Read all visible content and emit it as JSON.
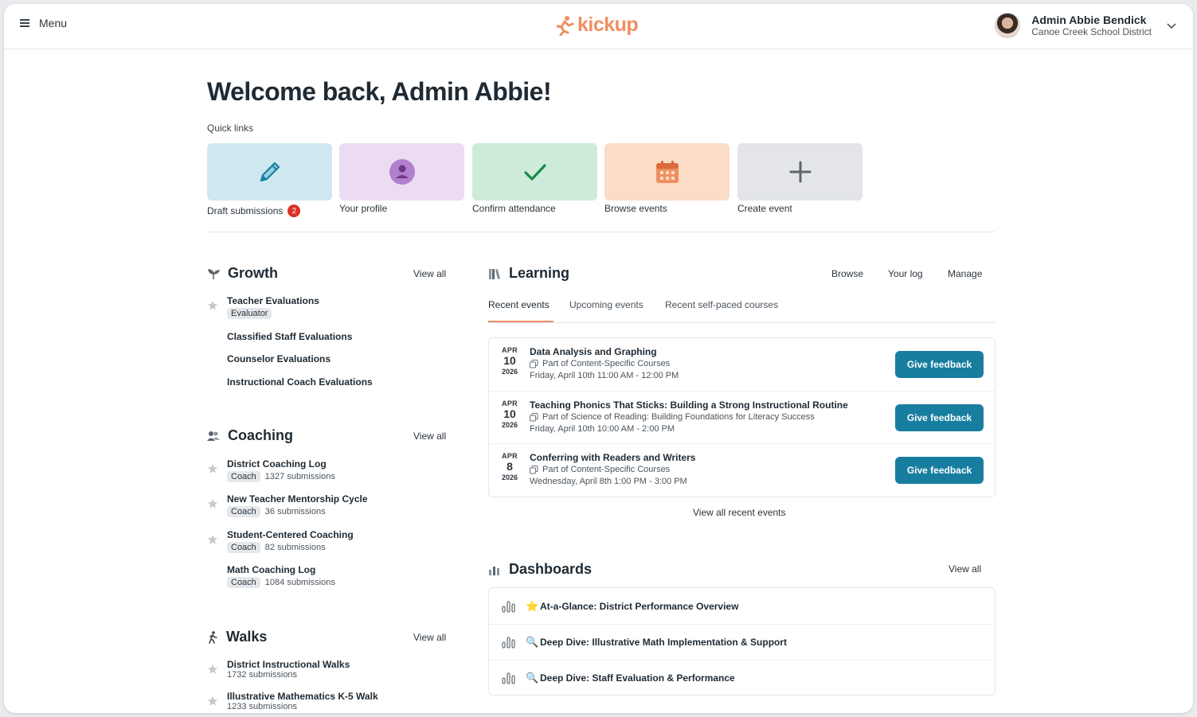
{
  "header": {
    "menu_label": "Menu",
    "logo_text": "kickup",
    "user_name": "Admin Abbie Bendick",
    "user_org": "Canoe Creek School District"
  },
  "welcome": "Welcome back, Admin Abbie!",
  "quick_links": {
    "label": "Quick links",
    "items": [
      {
        "label": "Draft submissions",
        "badge": "2",
        "color": "#cfe8ef",
        "icon": "pencil-icon"
      },
      {
        "label": "Your profile",
        "color": "#ecdcf1",
        "icon": "person-icon"
      },
      {
        "label": "Confirm attendance",
        "color": "#cdebd8",
        "icon": "check-icon"
      },
      {
        "label": "Browse events",
        "color": "#fbdcc7",
        "icon": "calendar-icon"
      },
      {
        "label": "Create event",
        "color": "#e3e5e8",
        "icon": "plus-icon"
      }
    ]
  },
  "growth": {
    "title": "Growth",
    "view_all": "View all",
    "items": [
      {
        "title": "Teacher Evaluations",
        "role": "Evaluator"
      },
      {
        "title": "Classified Staff Evaluations"
      },
      {
        "title": "Counselor Evaluations"
      },
      {
        "title": "Instructional Coach Evaluations"
      }
    ]
  },
  "coaching": {
    "title": "Coaching",
    "view_all": "View all",
    "items": [
      {
        "title": "District Coaching Log",
        "role": "Coach",
        "count": "1327 submissions"
      },
      {
        "title": "New Teacher Mentorship Cycle",
        "role": "Coach",
        "count": "36 submissions"
      },
      {
        "title": "Student-Centered Coaching",
        "role": "Coach",
        "count": "82 submissions"
      },
      {
        "title": "Math Coaching Log",
        "role": "Coach",
        "count": "1084 submissions"
      }
    ]
  },
  "walks": {
    "title": "Walks",
    "view_all": "View all",
    "items": [
      {
        "title": "District Instructional Walks",
        "count": "1732 submissions"
      },
      {
        "title": "Illustrative Mathematics K-5 Walk",
        "count": "1233 submissions"
      }
    ]
  },
  "learning": {
    "title": "Learning",
    "links": [
      "Browse",
      "Your log",
      "Manage"
    ],
    "tabs": [
      "Recent events",
      "Upcoming events",
      "Recent self-paced courses"
    ],
    "events": [
      {
        "month": "APR",
        "day": "10",
        "year": "2026",
        "title": "Data Analysis and Graphing",
        "part": "Part of Content-Specific Courses",
        "time": "Friday, April 10th 11:00 AM - 12:00 PM",
        "button": "Give feedback"
      },
      {
        "month": "APR",
        "day": "10",
        "year": "2026",
        "title": "Teaching Phonics That Sticks: Building a Strong Instructional Routine",
        "part": "Part of Science of Reading: Building Foundations for Literacy Success",
        "time": "Friday, April 10th 10:00 AM - 2:00 PM",
        "button": "Give feedback"
      },
      {
        "month": "APR",
        "day": "8",
        "year": "2026",
        "title": "Conferring with Readers and Writers",
        "part": "Part of Content-Specific Courses",
        "time": "Wednesday, April 8th 1:00 PM - 3:00 PM",
        "button": "Give feedback"
      }
    ],
    "view_all_recent": "View all recent events"
  },
  "dashboards": {
    "title": "Dashboards",
    "view_all": "View all",
    "items": [
      {
        "emoji": "⭐",
        "label": "At-a-Glance: District Performance Overview"
      },
      {
        "emoji": "🔍",
        "label": "Deep Dive: Illustrative Math Implementation & Support"
      },
      {
        "emoji": "🔍",
        "label": "Deep Dive: Staff Evaluation & Performance"
      }
    ]
  },
  "colors": {
    "accent": "#ef8f62",
    "button": "#177ea0",
    "badge": "#d93025"
  }
}
